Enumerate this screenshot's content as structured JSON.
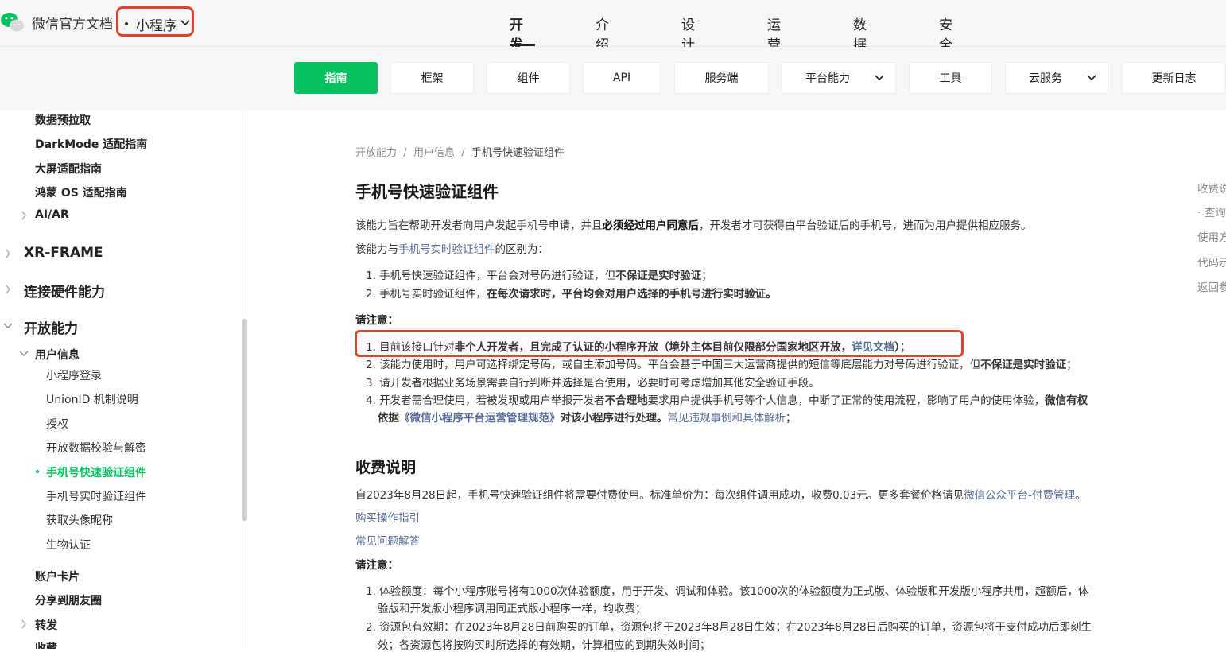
{
  "header": {
    "site_name": "微信官方文档",
    "product_select": "小程序",
    "nav": [
      "开发",
      "介绍",
      "设计",
      "运营",
      "数据",
      "安全"
    ],
    "active_nav": "开发"
  },
  "subnav": [
    "指南",
    "框架",
    "组件",
    "API",
    "服务端",
    "平台能力",
    "工具",
    "云服务",
    "更新日志"
  ],
  "sidebar": {
    "items": [
      "数据预拉取",
      "DarkMode 适配指南",
      "大屏适配指南",
      "鸿蒙 OS 适配指南",
      "AI/AR",
      "XR-FRAME",
      "连接硬件能力",
      "开放能力",
      "用户信息",
      "小程序登录",
      "UnionID 机制说明",
      "授权",
      "开放数据校验与解密",
      "手机号快速验证组件",
      "手机号实时验证组件",
      "获取头像昵称",
      "生物认证",
      "账户卡片",
      "分享到朋友圈",
      "转发",
      "收藏"
    ]
  },
  "breadcrumb": {
    "level1": "开放能力",
    "level2": "用户信息",
    "current": "手机号快速验证组件",
    "sep": "/"
  },
  "main": {
    "title": "手机号快速验证组件",
    "intro_1a": "该能力旨在帮助开发者向用户发起手机号申请，并且",
    "intro_1b": "必须经过用户同意后",
    "intro_1c": "，开发者才可获得由平台验证后的手机号，进而为用户提供相应服务。",
    "intro_2a": "该能力与",
    "intro_2_link": "手机号实时验证组件",
    "intro_2b": "的区别为：",
    "diff_1a": "1. 手机号快速验证组件，平台会对号码进行验证，但",
    "diff_1b": "不保证是实时验证",
    "diff_1c": "；",
    "diff_2a": "2. 手机号实时验证组件，",
    "diff_2b": "在每次请求时，平台均会对用户选择的手机号进行实时验证。",
    "note_label": "请注意：",
    "n1a": "1. 目前该接口针对",
    "n1b": "非个人开发者，且完成了认证的小程序开放（境外主体目前仅限部分国家地区开放，",
    "n1_link": "详见文档",
    "n1c": "）",
    "n1d": "；",
    "n2a": "2. 该能力使用时，用户可选择绑定号码，或自主添加号码。平台会基于中国三大运营商提供的短信等底层能力对号码进行验证，但",
    "n2b": "不保证是实时验证",
    "n2c": "；",
    "n3": "3. 请开发者根据业务场景需要自行判断并选择是否使用，必要时可考虑增加其他安全验证手段。",
    "n4a": "4. 开发者需合理使用，若被发现或用户举报开发者",
    "n4b": "不合理地",
    "n4c": "要求用户提供手机号等个人信息，中断了正常的使用流程，影响了用户的使用体验，",
    "n4d": "微信有权",
    "n4e": "依据",
    "n4_link1": "《微信小程序平台运营管理规范》",
    "n4f": "对该小程序进行处理。",
    "n4_link2": "常见违规事例和具体解析",
    "n4g": "；",
    "fee_title": "收费说明",
    "fee_1a": "自2023年8月28日起，手机号快速验证组件将需要付费使用。标准单价为：每次组件调用成功，收费0.03元。更多套餐价格请见",
    "fee_1_link": "微信公众平台-付费管理",
    "fee_1b": "。",
    "fee_link_buy": "购买操作指引",
    "fee_link_faq": "常见问题解答",
    "fee_note": "请注意：",
    "f1a": "1. 体验额度：每个小程序账号将有1000次体验额度，用于开发、调试和体验。该1000次的体验额度为正式版、体验版和开发版小程序共用，超额后，体",
    "f1b": "验版和开发版小程序调用同正式版小程序一样，均收费；",
    "f2a": "2. 资源包有效期：在2023年8月28日前购买的订单，资源包将于2023年8月28日生效；在2023年8月28日后购买的订单，资源包将于支付成功后即刻生",
    "f2b": "效；各资源包将按购买时所选择的有效期，计算相应的到期失效时间；"
  },
  "toc": [
    "收费说",
    "· 查询",
    "使用方",
    "代码示",
    "返回参"
  ],
  "colors": {
    "accent": "#07c160",
    "highlight": "#e2412b",
    "link": "#576b95"
  }
}
